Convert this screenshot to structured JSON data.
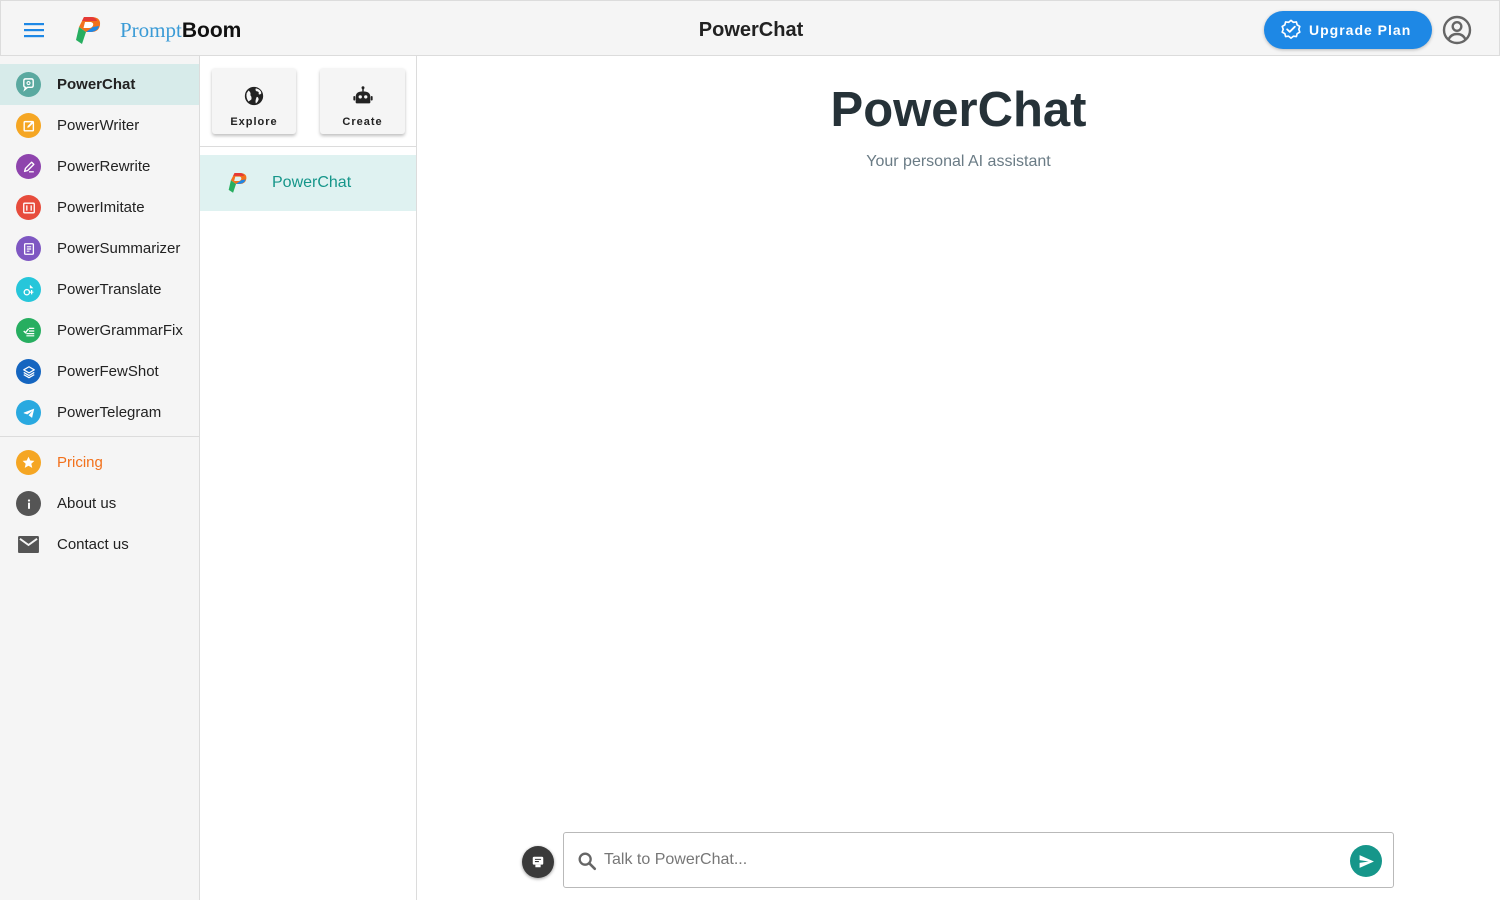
{
  "header": {
    "brand_part1": "Prompt",
    "brand_part2": "Boom",
    "title": "PowerChat",
    "upgrade_label": "Upgrade Plan"
  },
  "sidebar": {
    "apps": [
      {
        "label": "PowerChat",
        "icon": "chat-bubble-icon",
        "color": "#5aa9a0",
        "active": true
      },
      {
        "label": "PowerWriter",
        "icon": "edit-square-icon",
        "color": "#f5a623"
      },
      {
        "label": "PowerRewrite",
        "icon": "pen-icon",
        "color": "#8e44ad"
      },
      {
        "label": "PowerImitate",
        "icon": "imitate-icon",
        "color": "#e74c3c"
      },
      {
        "label": "PowerSummarizer",
        "icon": "document-icon",
        "color": "#7e57c2"
      },
      {
        "label": "PowerTranslate",
        "icon": "translate-icon",
        "color": "#26c6da"
      },
      {
        "label": "PowerGrammarFix",
        "icon": "checklist-icon",
        "color": "#27ae60"
      },
      {
        "label": "PowerFewShot",
        "icon": "layers-icon",
        "color": "#1565c0"
      },
      {
        "label": "PowerTelegram",
        "icon": "telegram-icon",
        "color": "#29a9e0"
      }
    ],
    "links": [
      {
        "label": "Pricing",
        "icon": "star-icon",
        "color": "#f5a623",
        "highlight": "#f2711c"
      },
      {
        "label": "About us",
        "icon": "info-icon",
        "color": "#555555"
      },
      {
        "label": "Contact us",
        "icon": "mail-icon",
        "color": "#555555"
      }
    ]
  },
  "middle": {
    "explore_label": "Explore",
    "create_label": "Create",
    "bots": [
      {
        "name": "PowerChat"
      }
    ]
  },
  "main": {
    "title": "PowerChat",
    "subtitle": "Your personal AI assistant",
    "input_placeholder": "Talk to PowerChat..."
  },
  "colors": {
    "accent": "#16968a",
    "upgrade": "#1e88e5",
    "active_bg": "#d7ebea"
  }
}
